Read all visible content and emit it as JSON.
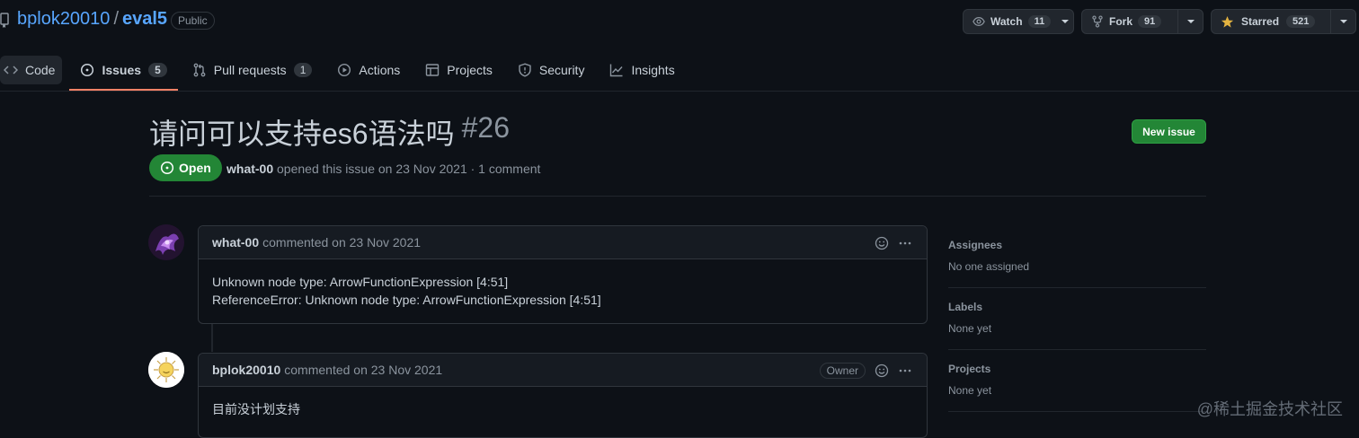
{
  "repo": {
    "owner": "bplok20010",
    "slash": "/",
    "name": "eval5",
    "visibility": "Public"
  },
  "actions": {
    "watch": {
      "label": "Watch",
      "count": "11"
    },
    "fork": {
      "label": "Fork",
      "count": "91"
    },
    "star": {
      "label": "Starred",
      "count": "521"
    }
  },
  "tabs": [
    {
      "label": "Code"
    },
    {
      "label": "Issues",
      "count": "5"
    },
    {
      "label": "Pull requests",
      "count": "1"
    },
    {
      "label": "Actions"
    },
    {
      "label": "Projects"
    },
    {
      "label": "Security"
    },
    {
      "label": "Insights"
    }
  ],
  "issue": {
    "title": "请问可以支持es6语法吗",
    "number": "#26",
    "state": "Open",
    "author": "what-00",
    "meta": "opened this issue on 23 Nov 2021 · 1 comment",
    "new_issue_label": "New issue"
  },
  "comments": [
    {
      "author": "what-00",
      "action": "commented on 23 Nov 2021",
      "lines": [
        "Unknown node type: ArrowFunctionExpression [4:51]",
        "ReferenceError: Unknown node type: ArrowFunctionExpression [4:51]"
      ]
    },
    {
      "author": "bplok20010",
      "action": "commented on 23 Nov 2021",
      "badge": "Owner",
      "lines": [
        "目前没计划支持"
      ]
    }
  ],
  "sidebar": {
    "assignees": {
      "heading": "Assignees",
      "value": "No one assigned"
    },
    "labels": {
      "heading": "Labels",
      "value": "None yet"
    },
    "projects": {
      "heading": "Projects",
      "value": "None yet"
    }
  },
  "watermark": "@稀土掘金技术社区",
  "colors": {
    "background": "#0d1117",
    "link": "#58a6ff",
    "open_green": "#238636",
    "tab_underline": "#f78166"
  }
}
